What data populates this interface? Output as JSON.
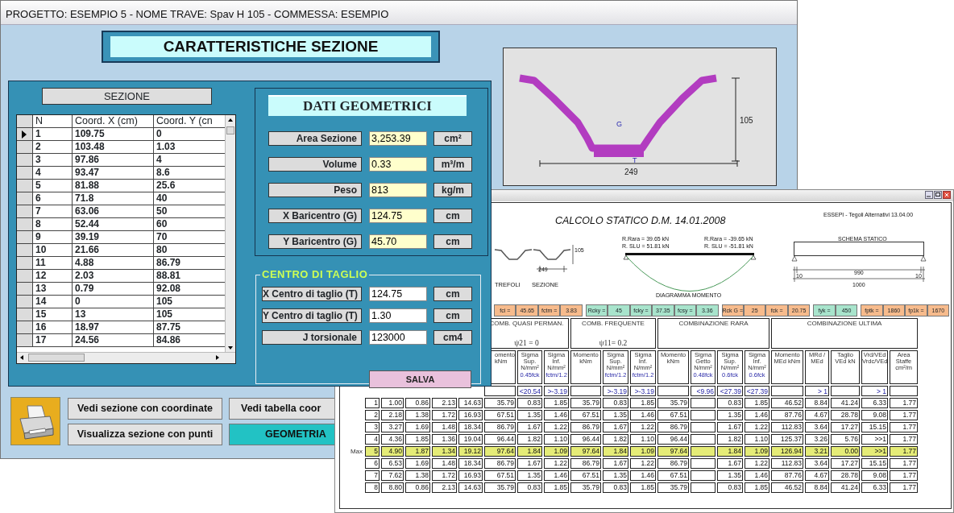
{
  "window": {
    "title": "PROGETTO: ESEMPIO 5 - NOME TRAVE: Spav H 105 - COMMESSA: ESEMPIO"
  },
  "heading": "CARATTERISTICHE SEZIONE",
  "section_table": {
    "title": "SEZIONE",
    "columns": [
      "N",
      "Coord. X (cm)",
      "Coord. Y (cn"
    ],
    "rows": [
      {
        "cells": [
          "1",
          "109.75",
          "0"
        ],
        "current": true
      },
      {
        "cells": [
          "2",
          "103.48",
          "1.03"
        ],
        "current": false
      },
      {
        "cells": [
          "3",
          "97.86",
          "4"
        ],
        "current": false
      },
      {
        "cells": [
          "4",
          "93.47",
          "8.6"
        ],
        "current": false
      },
      {
        "cells": [
          "5",
          "81.88",
          "25.6"
        ],
        "current": false
      },
      {
        "cells": [
          "6",
          "71.8",
          "40"
        ],
        "current": false
      },
      {
        "cells": [
          "7",
          "63.06",
          "50"
        ],
        "current": false
      },
      {
        "cells": [
          "8",
          "52.44",
          "60"
        ],
        "current": false
      },
      {
        "cells": [
          "9",
          "39.19",
          "70"
        ],
        "current": false
      },
      {
        "cells": [
          "10",
          "21.66",
          "80"
        ],
        "current": false
      },
      {
        "cells": [
          "11",
          "4.88",
          "86.79"
        ],
        "current": false
      },
      {
        "cells": [
          "12",
          "2.03",
          "88.81"
        ],
        "current": false
      },
      {
        "cells": [
          "13",
          "0.79",
          "92.08"
        ],
        "current": false
      },
      {
        "cells": [
          "14",
          "0",
          "105"
        ],
        "current": false
      },
      {
        "cells": [
          "15",
          "13",
          "105"
        ],
        "current": false
      },
      {
        "cells": [
          "16",
          "18.97",
          "87.75"
        ],
        "current": false
      },
      {
        "cells": [
          "17",
          "24.56",
          "84.86"
        ],
        "current": false
      }
    ]
  },
  "geometric_data": {
    "title": "DATI GEOMETRICI",
    "rows": [
      {
        "label": "Area Sezione",
        "value": "3,253.39",
        "unit": "cm²"
      },
      {
        "label": "Volume",
        "value": "0.33",
        "unit": "m³/m"
      },
      {
        "label": "Peso",
        "value": "813",
        "unit": "kg/m"
      },
      {
        "label": "X Baricentro (G)",
        "value": "124.75",
        "unit": "cm"
      },
      {
        "label": "Y Baricentro (G)",
        "value": "45.70",
        "unit": "cm"
      }
    ]
  },
  "shear_centre": {
    "title": "CENTRO DI TAGLIO",
    "rows": [
      {
        "label": "X Centro di taglio (T)",
        "value": "124.75",
        "unit": "cm"
      },
      {
        "label": "Y Centro di taglio (T)",
        "value": "1.30",
        "unit": "cm"
      },
      {
        "label": "J torsionale",
        "value": "123000",
        "unit": "cm4"
      }
    ],
    "save_button": "SALVA"
  },
  "preview": {
    "height_label": "105",
    "width_label": "249",
    "centroid_label": "G",
    "shear_label": "T"
  },
  "buttons": [
    {
      "label": "Vedi sezione con coordinate",
      "kind": "plain"
    },
    {
      "label": "Vedi tabella coor",
      "kind": "plain"
    },
    {
      "label": "Visualizza sezione con punti",
      "kind": "plain"
    },
    {
      "label": "GEOMETRIA",
      "kind": "accent"
    }
  ],
  "report": {
    "title": "CALCOLO STATICO D.M. 14.01.2008",
    "program_note": "ESSEPI - Tegoli Alternativi 13.04.00",
    "section_sketch": {
      "height_label": "105",
      "width_label": "249",
      "captions": [
        "TREFOLI",
        "SEZIONE"
      ]
    },
    "moment_diagram": {
      "left_reactions": [
        "R.Rara = 39.65 kN",
        "R. SLU = 51.81 kN"
      ],
      "right_reactions": [
        "R.Rara = -39.65 kN",
        "R. SLU = -51.81 kN"
      ],
      "caption": "DIAGRAMMA MOMENTO"
    },
    "static_scheme": {
      "title": "SCHEMA STATICO",
      "span": "990",
      "left_support": "10",
      "right_support": "10",
      "length": "1000"
    },
    "materials": [
      {
        "color": "#f7bb8c",
        "cells": [
          "fci =",
          "45.65",
          "fctm =",
          "3.83"
        ]
      },
      {
        "color": "#a8e4cc",
        "cells": [
          "Rcky =",
          "45",
          "fcky =",
          "37.35",
          "fcsy =",
          "3.36"
        ]
      },
      {
        "color": "#f7bb8c",
        "cells": [
          "Rck G =",
          "25",
          "fck =",
          "20.75"
        ]
      },
      {
        "color": "#a8e4cc",
        "cells": [
          "fyk =",
          "450"
        ]
      },
      {
        "color": "#f7bb8c",
        "cells": [
          "fptk =",
          "1860",
          "fp1k =",
          "1670"
        ]
      }
    ],
    "combinations": [
      {
        "title": "COMB. QUASI PERMAN.",
        "factor": "ψ21 = 0"
      },
      {
        "title": "COMB.  FREQUENTE",
        "factor": "ψ11= 0.2"
      },
      {
        "title": "COMBINAZIONE  RARA"
      },
      {
        "title": "COMBINAZIONE ULTIMA"
      }
    ],
    "columns": [
      {
        "heading": "omento kNm",
        "kind": "value"
      },
      {
        "heading": "Sigma Sup. N/mm²",
        "limit_label": "0.45fck",
        "limit": "<20.54",
        "kind": "value"
      },
      {
        "heading": "Sigma Inf. N/mm²",
        "limit_label": "fctm/1.2",
        "limit": ">-3.19",
        "kind": "value"
      },
      {
        "heading": "Momento kNm",
        "kind": "value"
      },
      {
        "heading": "Sigma Sup. N/mm²",
        "limit_label": "fctm/1.2",
        "limit": ">-3.19",
        "kind": "value"
      },
      {
        "heading": "Sigma Inf. N/mm²",
        "limit_label": "fctm/1.2",
        "limit": ">-3.19",
        "kind": "value"
      },
      {
        "heading": "Momento kNm",
        "kind": "value"
      },
      {
        "heading": "Sigma Getto N/mm²",
        "limit_label": "0.48fck",
        "limit": "<9.96",
        "kind": "empty"
      },
      {
        "heading": "Sigma Sup. N/mm²",
        "limit_label": "0.6fck",
        "limit": "<27.39",
        "kind": "value"
      },
      {
        "heading": "Sigma Inf. N/mm²",
        "limit_label": "0.6fck",
        "limit": "<27.39",
        "kind": "value"
      },
      {
        "heading": "Momento MEd kNm",
        "kind": "value"
      },
      {
        "heading": "MRd / MEd",
        "limit": "> 1",
        "kind": "value"
      },
      {
        "heading": "Taglio VEd kN",
        "kind": "value"
      },
      {
        "heading": "Vrd/VEd Vrdc/VEd",
        "limit": "> 1",
        "kind": "value"
      },
      {
        "heading": "Area Staffe cm²/m",
        "kind": "value"
      }
    ],
    "rows": [
      {
        "n": "1",
        "max": false,
        "values": [
          "1.00",
          "0.86",
          "2.13",
          "14.63",
          "35.79",
          "0.83",
          "1.85",
          "35.79",
          "0.83",
          "1.85",
          "35.79",
          "0.83",
          "1.85",
          "46.52",
          "8.84",
          "41.24",
          "6.33",
          "1.77"
        ]
      },
      {
        "n": "2",
        "max": false,
        "values": [
          "2.18",
          "1.38",
          "1.72",
          "16.93",
          "67.51",
          "1.35",
          "1.46",
          "67.51",
          "1.35",
          "1.46",
          "67.51",
          "1.35",
          "1.46",
          "87.76",
          "4.67",
          "28.78",
          "9.08",
          "1.77"
        ]
      },
      {
        "n": "3",
        "max": false,
        "values": [
          "3.27",
          "1.69",
          "1.48",
          "18.34",
          "86.79",
          "1.67",
          "1.22",
          "86.79",
          "1.67",
          "1.22",
          "86.79",
          "1.67",
          "1.22",
          "112.83",
          "3.64",
          "17.27",
          "15.15",
          "1.77"
        ]
      },
      {
        "n": "4",
        "max": false,
        "values": [
          "4.36",
          "1.85",
          "1.36",
          "19.04",
          "96.44",
          "1.82",
          "1.10",
          "96.44",
          "1.82",
          "1.10",
          "96.44",
          "1.82",
          "1.10",
          "125.37",
          "3.26",
          "5.76",
          ">>1",
          "1.77"
        ]
      },
      {
        "n": "5",
        "max": true,
        "side_label": "Max",
        "values": [
          "4.90",
          "1.87",
          "1.34",
          "19.12",
          "97.64",
          "1.84",
          "1.09",
          "97.64",
          "1.84",
          "1.09",
          "97.64",
          "1.84",
          "1.09",
          "126.94",
          "3.21",
          "0.00",
          ">>1",
          "1.77"
        ]
      },
      {
        "n": "6",
        "max": false,
        "values": [
          "6.53",
          "1.69",
          "1.48",
          "18.34",
          "86.79",
          "1.67",
          "1.22",
          "86.79",
          "1.67",
          "1.22",
          "86.79",
          "1.67",
          "1.22",
          "112.83",
          "3.64",
          "17.27",
          "15.15",
          "1.77"
        ]
      },
      {
        "n": "7",
        "max": false,
        "values": [
          "7.62",
          "1.38",
          "1.72",
          "16.93",
          "67.51",
          "1.35",
          "1.46",
          "67.51",
          "1.35",
          "1.46",
          "67.51",
          "1.35",
          "1.46",
          "87.76",
          "4.67",
          "28.78",
          "9.08",
          "1.77"
        ]
      },
      {
        "n": "8",
        "max": false,
        "values": [
          "8.80",
          "0.86",
          "2.13",
          "14.63",
          "35.79",
          "0.83",
          "1.85",
          "35.79",
          "0.83",
          "1.85",
          "35.79",
          "0.83",
          "1.85",
          "46.52",
          "8.84",
          "41.24",
          "6.33",
          "1.77"
        ]
      }
    ]
  }
}
